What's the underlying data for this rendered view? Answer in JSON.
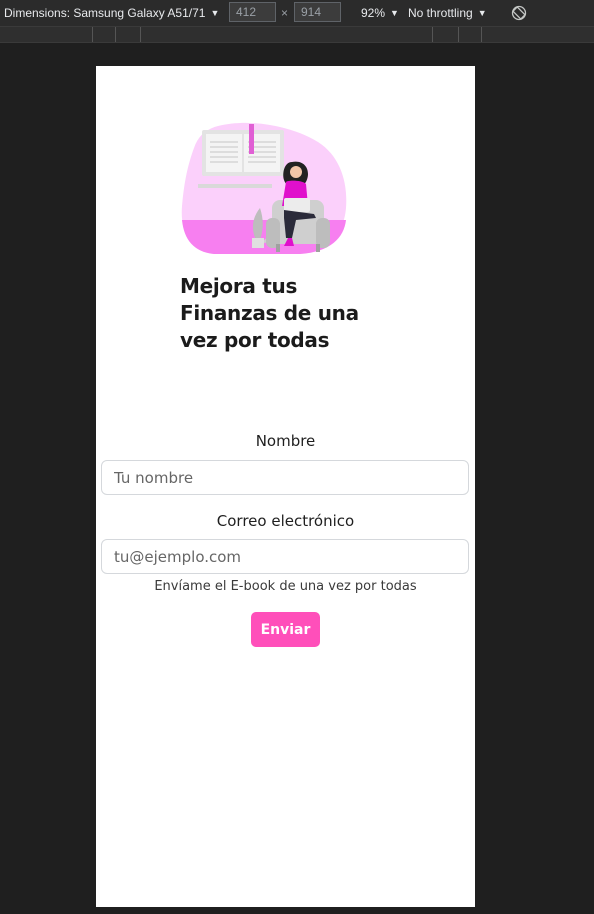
{
  "devtools": {
    "device_label": "Dimensions: Samsung Galaxy A51/71",
    "width": "412",
    "height": "914",
    "times_symbol": "×",
    "zoom": "92%",
    "throttling": "No throttling"
  },
  "page": {
    "headline": "Mejora tus Finanzas de una vez por todas",
    "form": {
      "name_label": "Nombre",
      "name_placeholder": "Tu nombre",
      "name_value": "",
      "email_label": "Correo electrónico",
      "email_placeholder": "tu@ejemplo.com",
      "email_value": "",
      "consent_text": "Envíame el E-book de una vez por todas",
      "submit_label": "Enviar"
    }
  },
  "colors": {
    "accent": "#ff4fba",
    "illustration_blob": "#fbd0fb",
    "illustration_floor": "#f77ff0",
    "page_background": "#ffffff",
    "devtools_background": "#1f1f1f"
  }
}
